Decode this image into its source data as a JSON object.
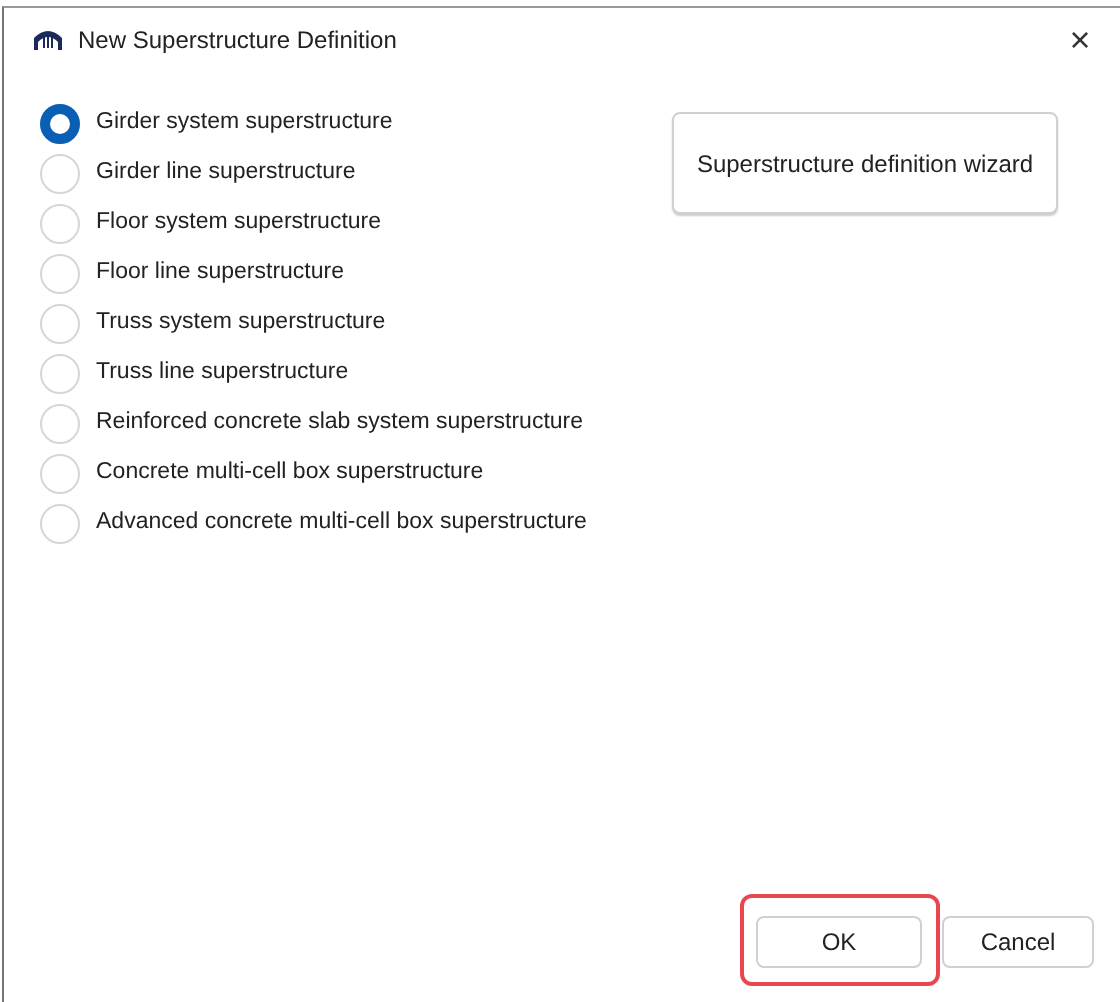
{
  "window": {
    "title": "New Superstructure Definition",
    "close": "×"
  },
  "options": [
    {
      "label": "Girder system superstructure",
      "selected": true
    },
    {
      "label": "Girder line superstructure",
      "selected": false
    },
    {
      "label": "Floor system superstructure",
      "selected": false
    },
    {
      "label": "Floor line superstructure",
      "selected": false
    },
    {
      "label": "Truss system superstructure",
      "selected": false
    },
    {
      "label": "Truss line superstructure",
      "selected": false
    },
    {
      "label": "Reinforced concrete slab system superstructure",
      "selected": false
    },
    {
      "label": "Concrete multi-cell box superstructure",
      "selected": false
    },
    {
      "label": "Advanced concrete multi-cell box superstructure",
      "selected": false
    }
  ],
  "wizard_button": "Superstructure definition wizard",
  "buttons": [
    {
      "label": "OK",
      "highlighted": true
    },
    {
      "label": "Cancel",
      "highlighted": false
    }
  ]
}
